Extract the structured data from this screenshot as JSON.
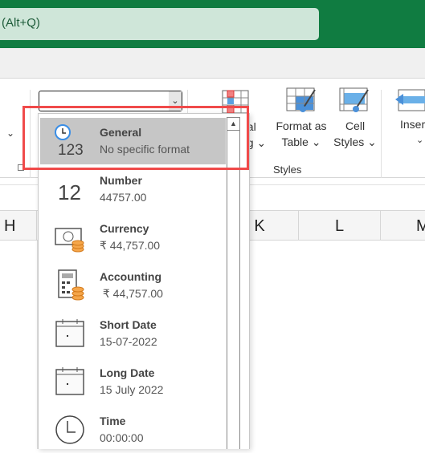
{
  "search": {
    "placeholder_tail": "(Alt+Q)"
  },
  "ribbon": {
    "conditional_formatting": {
      "line1": "nal",
      "line2": "ng ⌄"
    },
    "format_as_table": {
      "line1": "Format as",
      "line2": "Table ⌄"
    },
    "cell_styles": {
      "line1": "Cell",
      "line2": "Styles ⌄"
    },
    "styles_group_label": "Styles",
    "insert": {
      "line1": "Inser",
      "line2": "⌄"
    },
    "left_chevron": "⌄"
  },
  "columns": [
    "H",
    "K",
    "L",
    "M"
  ],
  "number_format_combo": {
    "value": ""
  },
  "format_list": [
    {
      "name": "General",
      "example": "No specific format",
      "icon": "general-123-icon",
      "selected": true,
      "glyph": "123"
    },
    {
      "name": "Number",
      "example": "44757.00",
      "icon": "number-12-icon",
      "glyph": "12"
    },
    {
      "name": "Currency",
      "example": "₹ 44,757.00",
      "icon": "currency-icon"
    },
    {
      "name": "Accounting",
      "example": " ₹ 44,757.00",
      "icon": "accounting-calculator-icon"
    },
    {
      "name": "Short Date",
      "example": "15-07-2022",
      "icon": "calendar-icon"
    },
    {
      "name": "Long Date",
      "example": "15 July 2022",
      "icon": "calendar-icon"
    },
    {
      "name": "Time",
      "example": "00:00:00",
      "icon": "clock-icon"
    }
  ],
  "colors": {
    "title_bar": "#107c41",
    "selection": "#c6c6c6",
    "highlight_box": "#f04a4a",
    "coins": "#e8892b"
  }
}
